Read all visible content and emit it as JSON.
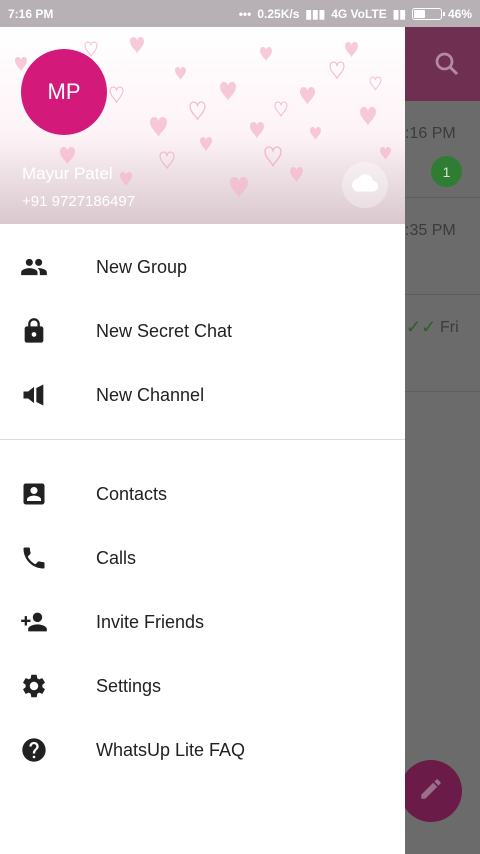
{
  "status_bar": {
    "time": "7:16 PM",
    "network_speed": "0.25K/s",
    "network_type": "4G VoLTE",
    "battery": "46%",
    "battery_level": 0.46
  },
  "background_list": {
    "rows": [
      {
        "time": ":16 PM",
        "badge": "1"
      },
      {
        "time": ":35 PM"
      },
      {
        "check": "✓✓",
        "time": "Fri"
      }
    ]
  },
  "drawer": {
    "avatar_initials": "MP",
    "user_name": "Mayur Patel",
    "user_phone": "+91 9727186497",
    "menu_primary": [
      {
        "label": "New Group",
        "icon": "group-icon"
      },
      {
        "label": "New Secret Chat",
        "icon": "lock-icon"
      },
      {
        "label": "New Channel",
        "icon": "megaphone-icon"
      }
    ],
    "menu_secondary": [
      {
        "label": "Contacts",
        "icon": "contacts-icon"
      },
      {
        "label": "Calls",
        "icon": "phone-icon"
      },
      {
        "label": "Invite Friends",
        "icon": "add-person-icon"
      },
      {
        "label": "Settings",
        "icon": "gear-icon"
      },
      {
        "label": "WhatsUp Lite FAQ",
        "icon": "help-icon"
      }
    ]
  },
  "colors": {
    "avatar": "#d31a7a",
    "header_bg": "#6f2f51",
    "badge": "#2e7d32",
    "fab": "#6a1b47"
  }
}
